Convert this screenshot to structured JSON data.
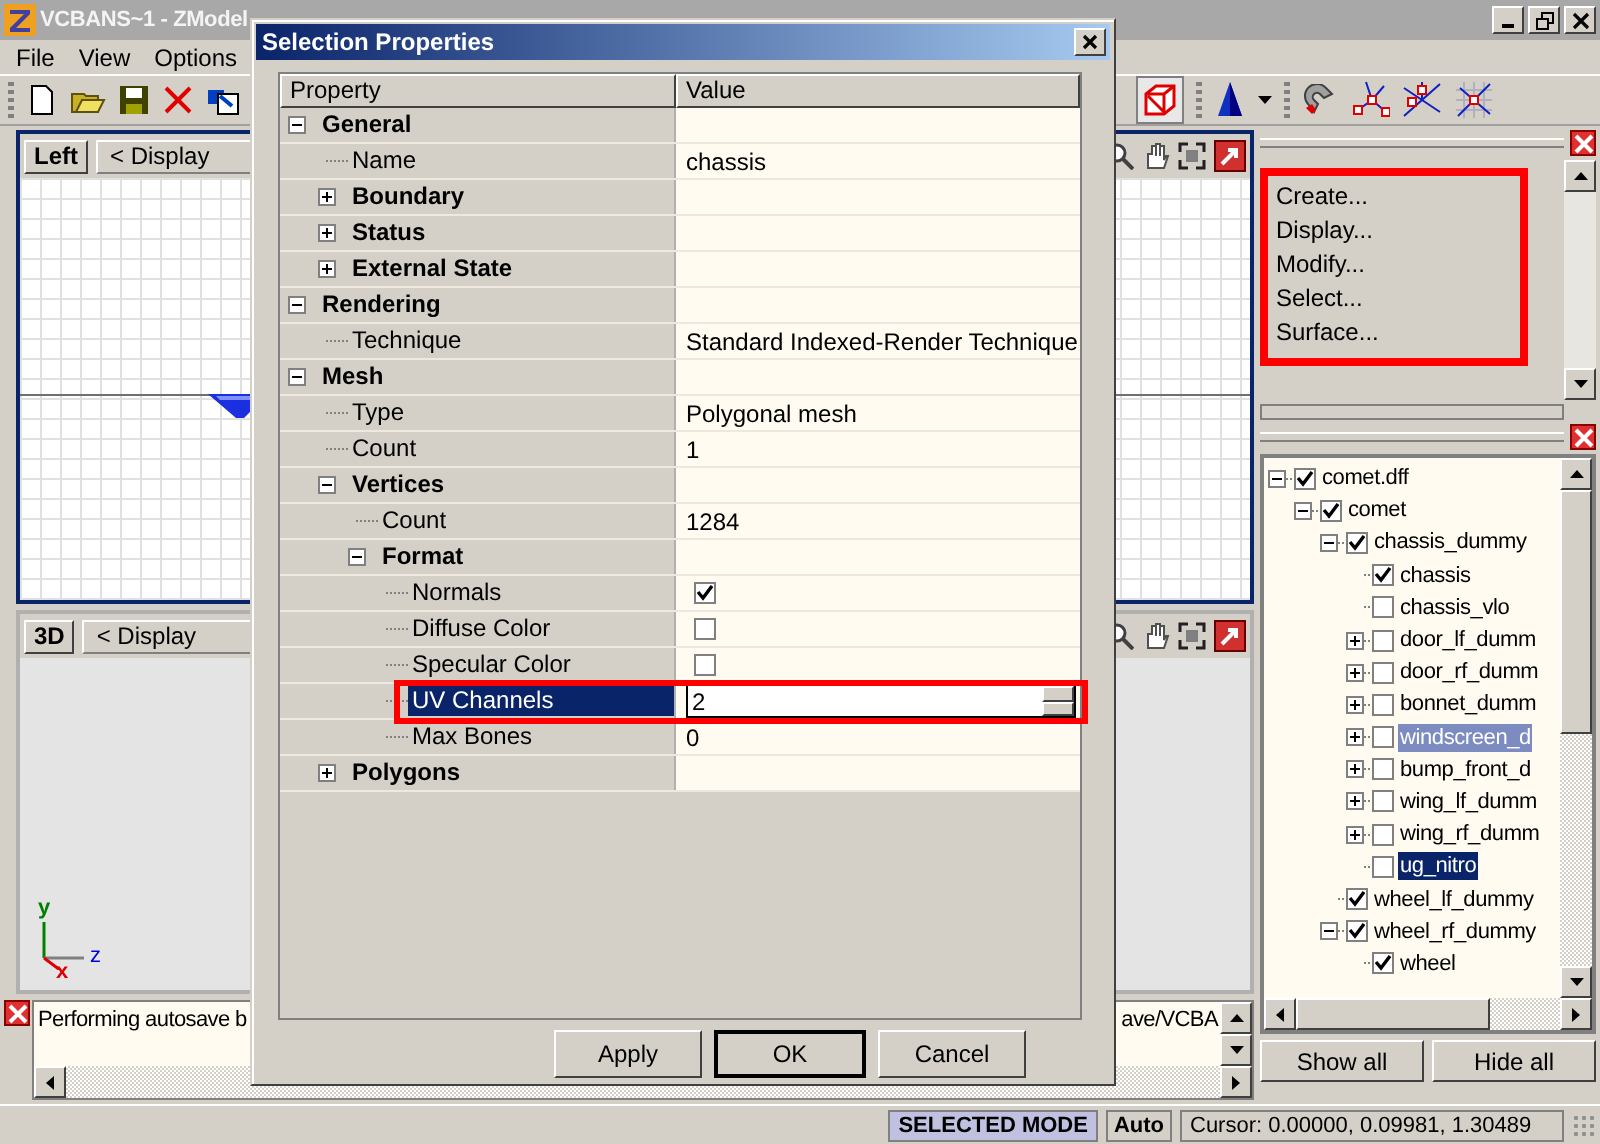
{
  "app_window": {
    "title": "VCBANS~1 - ZModel",
    "menu": [
      "File",
      "View",
      "Options"
    ]
  },
  "viewports": [
    {
      "view": "Left",
      "mode": "< Display",
      "kind": "grid"
    },
    {
      "view": "3D",
      "mode": "< Display",
      "kind": "shaded",
      "axis_labels": [
        "y",
        "z",
        "x"
      ]
    }
  ],
  "log": {
    "text": "Performing autosave b",
    "tail": "ave/VCBA"
  },
  "command_panel": {
    "items": [
      "Create...",
      "Display...",
      "Modify...",
      "Select...",
      "Surface..."
    ]
  },
  "scene_tree": {
    "items": [
      {
        "label": "comet.dff",
        "checked": true,
        "expanded": true,
        "selected": false,
        "hovered": false,
        "children": [
          {
            "label": "comet",
            "checked": true,
            "expanded": true,
            "selected": false,
            "hovered": false,
            "children": [
              {
                "label": "chassis_dummy",
                "checked": true,
                "expanded": true,
                "selected": false,
                "hovered": false,
                "children": [
                  {
                    "label": "chassis",
                    "checked": true,
                    "selected": false,
                    "hovered": false
                  },
                  {
                    "label": "chassis_vlo",
                    "checked": false,
                    "selected": false,
                    "hovered": false
                  },
                  {
                    "label": "door_lf_dumm",
                    "checked": false,
                    "expanded": false,
                    "selected": false,
                    "hovered": false
                  },
                  {
                    "label": "door_rf_dumm",
                    "checked": false,
                    "expanded": false,
                    "selected": false,
                    "hovered": false
                  },
                  {
                    "label": "bonnet_dumm",
                    "checked": false,
                    "expanded": false,
                    "selected": false,
                    "hovered": false
                  },
                  {
                    "label": "windscreen_d",
                    "checked": false,
                    "expanded": false,
                    "selected": false,
                    "hovered": true
                  },
                  {
                    "label": "bump_front_d",
                    "checked": false,
                    "expanded": false,
                    "selected": false,
                    "hovered": false
                  },
                  {
                    "label": "wing_lf_dumm",
                    "checked": false,
                    "expanded": false,
                    "selected": false,
                    "hovered": false
                  },
                  {
                    "label": "wing_rf_dumm",
                    "checked": false,
                    "expanded": false,
                    "selected": false,
                    "hovered": false
                  },
                  {
                    "label": "ug_nitro",
                    "checked": false,
                    "selected": true,
                    "hovered": false
                  }
                ]
              },
              {
                "label": "wheel_lf_dummy",
                "checked": true,
                "selected": false,
                "hovered": false
              },
              {
                "label": "wheel_rf_dummy",
                "checked": true,
                "expanded": true,
                "selected": false,
                "hovered": false,
                "children": [
                  {
                    "label": "wheel",
                    "checked": true,
                    "selected": false,
                    "hovered": false
                  }
                ]
              }
            ]
          }
        ]
      }
    ],
    "buttons": [
      "Show all",
      "Hide all"
    ]
  },
  "status_bar": {
    "mode": "SELECTED MODE",
    "auto": "Auto",
    "cursor": "Cursor: 0.00000, 0.09981, 1.30489"
  },
  "dialog": {
    "title": "Selection Properties",
    "columns": [
      "Property",
      "Value"
    ],
    "rows": [
      {
        "kind": "category",
        "label": "General",
        "expanded": true,
        "selected": false,
        "children": [
          {
            "kind": "text",
            "label": "Name",
            "value": "chassis",
            "selected": false
          },
          {
            "kind": "group",
            "label": "Boundary",
            "expanded": false,
            "selected": false
          },
          {
            "kind": "group",
            "label": "Status",
            "expanded": false,
            "selected": false
          },
          {
            "kind": "group",
            "label": "External State",
            "expanded": false,
            "selected": false
          }
        ]
      },
      {
        "kind": "category",
        "label": "Rendering",
        "expanded": true,
        "selected": false,
        "children": [
          {
            "kind": "text",
            "label": "Technique",
            "value": "Standard Indexed-Render Technique",
            "selected": false
          }
        ]
      },
      {
        "kind": "category",
        "label": "Mesh",
        "expanded": true,
        "selected": false,
        "children": [
          {
            "kind": "text",
            "label": "Type",
            "value": "Polygonal mesh",
            "selected": false
          },
          {
            "kind": "text",
            "label": "Count",
            "value": "1",
            "selected": false
          },
          {
            "kind": "group",
            "label": "Vertices",
            "expanded": true,
            "selected": false,
            "children": [
              {
                "kind": "text",
                "label": "Count",
                "value": "1284",
                "selected": false
              },
              {
                "kind": "group",
                "label": "Format",
                "expanded": true,
                "selected": false,
                "children": [
                  {
                    "kind": "check",
                    "label": "Normals",
                    "checked": true,
                    "selected": false
                  },
                  {
                    "kind": "check",
                    "label": "Diffuse Color",
                    "checked": false,
                    "selected": false
                  },
                  {
                    "kind": "check",
                    "label": "Specular Color",
                    "checked": false,
                    "selected": false
                  },
                  {
                    "kind": "spin",
                    "label": "UV Channels",
                    "value": "2",
                    "selected": true
                  },
                  {
                    "kind": "text",
                    "label": "Max Bones",
                    "value": "0",
                    "selected": false
                  }
                ]
              }
            ]
          },
          {
            "kind": "group",
            "label": "Polygons",
            "expanded": false,
            "selected": false
          }
        ]
      }
    ],
    "buttons": [
      {
        "label": "Apply",
        "default": false
      },
      {
        "label": "OK",
        "default": true
      },
      {
        "label": "Cancel",
        "default": false
      }
    ]
  }
}
